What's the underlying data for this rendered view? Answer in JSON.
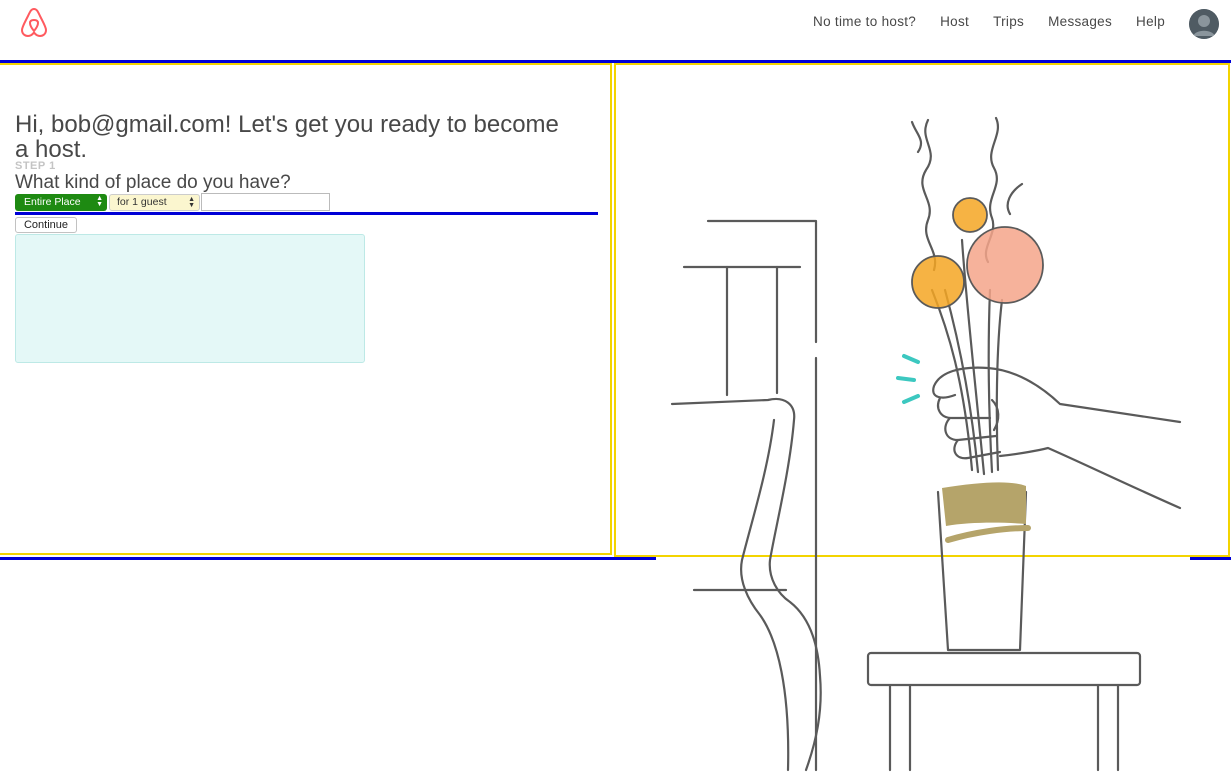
{
  "nav": {
    "items": [
      "No time to host?",
      "Host",
      "Trips",
      "Messages",
      "Help"
    ]
  },
  "icons": {
    "logo": "airbnb-logo-icon",
    "avatar": "user-avatar-icon"
  },
  "colors": {
    "brand": "#ff5a5f",
    "accent_green": "#1e8a12",
    "border_yellow": "#f3d400",
    "border_blue": "#0000d6",
    "panel_cyan": "#e4f8f7",
    "flower_orange": "#f5a623",
    "flower_pink": "#f4a58a",
    "vase_band": "#b5a46a",
    "sparkle": "#3cc8c0"
  },
  "main": {
    "heading": "Hi, bob@gmail.com! Let's get you ready to become a host.",
    "step_label": "STEP 1",
    "question": "What kind of place do you have?",
    "place_select": "Entire Place",
    "guest_select": "for 1 guest",
    "text_input_value": "",
    "continue_label": "Continue"
  }
}
